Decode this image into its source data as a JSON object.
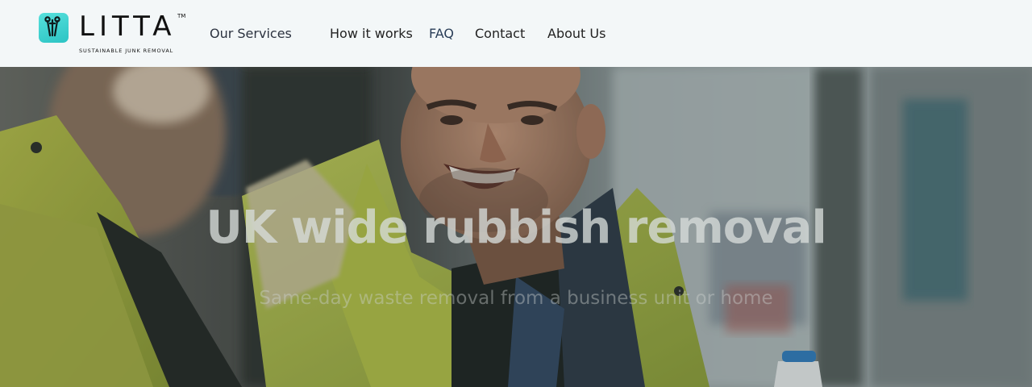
{
  "brand": {
    "name": "LITTA",
    "trademark": "TM",
    "tagline": "SUSTAINABLE JUNK REMOVAL",
    "logo_icon": "litta-tools-icon",
    "accent": "#3fd3d1"
  },
  "nav": {
    "items": [
      {
        "label": "Our Services"
      },
      {
        "label": "How it works"
      },
      {
        "label": "FAQ"
      },
      {
        "label": "Contact"
      },
      {
        "label": "About Us"
      }
    ]
  },
  "hero": {
    "title": "UK wide rubbish removal",
    "subtitle": "Same-day waste removal from a business unit or home",
    "image_subject": "smiling worker in high-visibility jacket inside a van"
  },
  "colors": {
    "header_bg": "#f3f7f8",
    "hero_title": "#d7dcda",
    "hi_vis_yellow": "#c9d84a"
  }
}
